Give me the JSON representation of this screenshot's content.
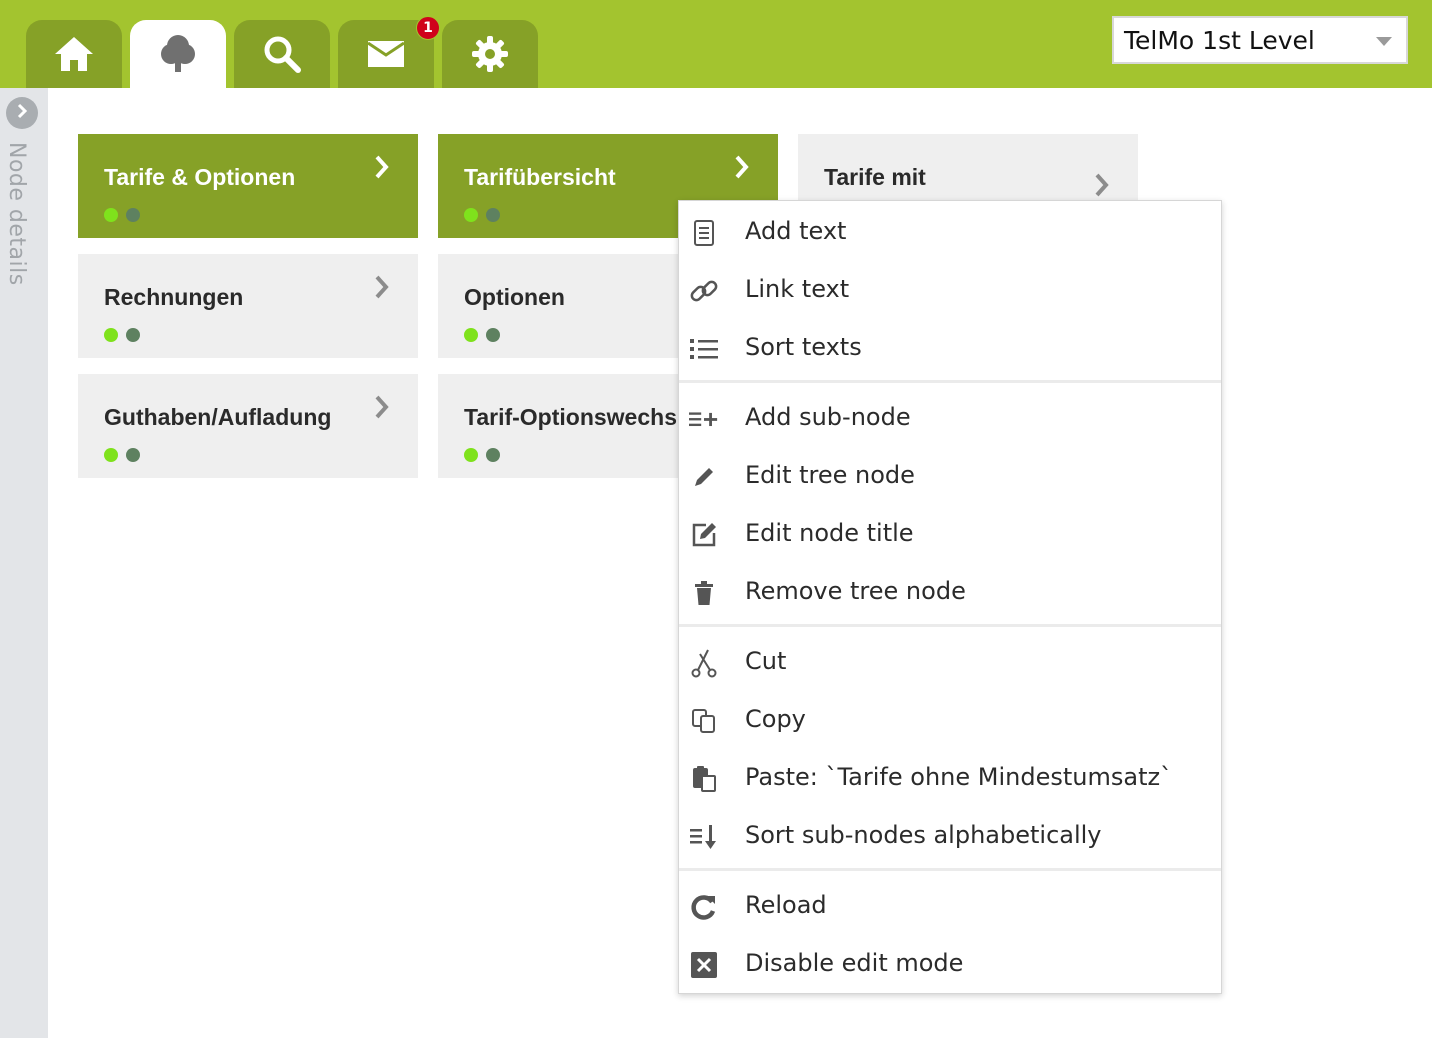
{
  "header": {
    "tabs": [
      {
        "name": "home",
        "icon": "home-icon"
      },
      {
        "name": "tree",
        "icon": "tree-icon",
        "active": true
      },
      {
        "name": "search",
        "icon": "search-icon"
      },
      {
        "name": "messages",
        "icon": "mail-icon",
        "badge": "1"
      },
      {
        "name": "settings",
        "icon": "gear-icon"
      }
    ],
    "level_select": {
      "value": "TelMo 1st Level"
    }
  },
  "side_panel": {
    "label": "Node details"
  },
  "tiles": [
    {
      "title": "Tarife & Optionen",
      "active": true
    },
    {
      "title": "Tarifübersicht",
      "active": true
    },
    {
      "title": "Tarife mit",
      "active": false
    },
    {
      "title": "Rechnungen",
      "active": false
    },
    {
      "title": "Optionen",
      "active": false
    },
    {
      "title": "Guthaben/Aufladung",
      "active": false
    },
    {
      "title": "Tarif-Optionswechs",
      "active": false
    }
  ],
  "context_menu": {
    "items": [
      {
        "label": "Add text",
        "icon": "document-icon"
      },
      {
        "label": "Link text",
        "icon": "link-icon"
      },
      {
        "label": "Sort texts",
        "icon": "list-icon"
      },
      {
        "label": "Add sub-node",
        "icon": "add-list-icon"
      },
      {
        "label": "Edit tree node",
        "icon": "pencil-icon"
      },
      {
        "label": "Edit node title",
        "icon": "edit-box-icon"
      },
      {
        "label": "Remove tree node",
        "icon": "trash-icon"
      },
      {
        "label": "Cut",
        "icon": "scissors-icon"
      },
      {
        "label": "Copy",
        "icon": "copy-icon"
      },
      {
        "label": "Paste:  `Tarife ohne Mindestumsatz`",
        "icon": "paste-icon"
      },
      {
        "label": "Sort sub-nodes alphabetically",
        "icon": "sort-icon"
      },
      {
        "label": "Reload",
        "icon": "reload-icon"
      },
      {
        "label": "Disable edit mode",
        "icon": "close-box-icon"
      }
    ]
  },
  "colors": {
    "header_green": "#a3c42f",
    "tab_green": "#86a127",
    "dot_on": "#7fe21c",
    "dot_off": "#5e8160",
    "badge_red": "#d0021b"
  }
}
